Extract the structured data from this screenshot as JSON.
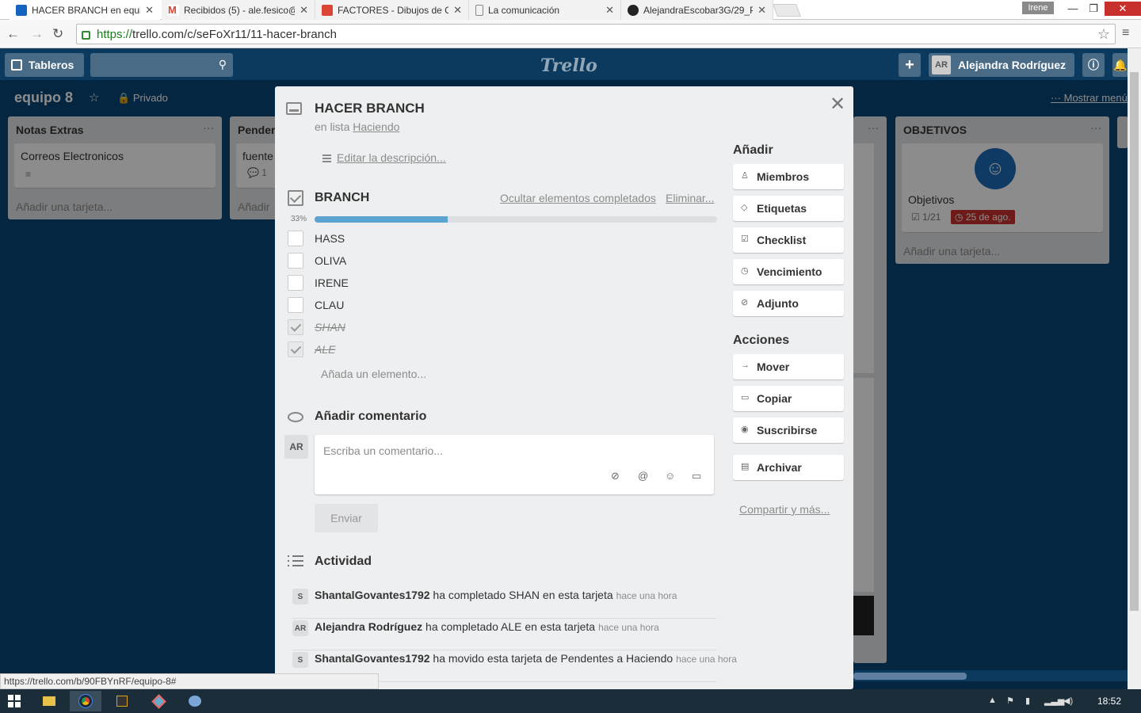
{
  "browser": {
    "tabs": [
      {
        "title": "HACER BRANCH en equip",
        "favicon_color": "#1565c0",
        "active": true
      },
      {
        "title": "Recibidos (5) - ale.fesico@",
        "favicon_color": "#d44638",
        "active": false
      },
      {
        "title": "FACTORES - Dibujos de G",
        "favicon_color": "#db4437",
        "active": false
      },
      {
        "title": "La comunicación",
        "favicon_color": "#ffffff",
        "active": false
      },
      {
        "title": "AlejandraEscobar3G/29_P",
        "favicon_color": "#222222",
        "active": false
      }
    ],
    "profile": "Irene",
    "url_scheme": "https://",
    "url_rest": "trello.com/c/seFoXr11/11-hacer-branch",
    "status_url": "https://trello.com/b/90FBYnRF/equipo-8#"
  },
  "trello_header": {
    "boards_label": "Tableros",
    "logo": "Trello",
    "user_initials": "AR",
    "user_name": "Alejandra Rodríguez"
  },
  "board": {
    "name": "equipo 8",
    "visibility": "Privado",
    "show_menu": "Mostrar menú",
    "lists": [
      {
        "title": "Notas Extras",
        "cards": [
          {
            "title": "Correos Electronicos"
          }
        ],
        "add_card": "Añadir una tarjeta..."
      },
      {
        "title": "Pender",
        "cards": [
          {
            "title": "fuente",
            "comments": "1"
          }
        ],
        "add_card": "Añadir"
      },
      {
        "title": "OBJETIVOS",
        "cards": [
          {
            "title": "Objetivos",
            "checklist": "1/21",
            "due": "25 de ago."
          }
        ],
        "add_card": "Añadir una tarjeta..."
      }
    ]
  },
  "card": {
    "title": "HACER BRANCH",
    "in_list_prefix": "en lista",
    "list_name": "Haciendo",
    "edit_description": "Editar la descripción...",
    "checklist": {
      "title": "BRANCH",
      "hide_completed": "Ocultar elementos completados",
      "delete": "Eliminar...",
      "percent_label": "33%",
      "progress": 0.33,
      "items": [
        {
          "text": "HASS",
          "done": false
        },
        {
          "text": "OLIVA",
          "done": false
        },
        {
          "text": "IRENE",
          "done": false
        },
        {
          "text": "CLAU",
          "done": false
        },
        {
          "text": "SHAN",
          "done": true
        },
        {
          "text": "ALE",
          "done": true
        }
      ],
      "add_item": "Añada un elemento..."
    },
    "comment": {
      "title": "Añadir comentario",
      "avatar": "AR",
      "placeholder": "Escriba un comentario...",
      "send": "Enviar"
    },
    "activity": {
      "title": "Actividad",
      "entries": [
        {
          "avatar": "S",
          "user": "ShantalGovantes1792",
          "action": "ha completado SHAN en esta tarjeta",
          "time": "hace una hora"
        },
        {
          "avatar": "AR",
          "user": "Alejandra Rodríguez",
          "action": "ha completado ALE en esta tarjeta",
          "time": "hace una hora"
        },
        {
          "avatar": "S",
          "user": "ShantalGovantes1792",
          "action": "ha movido esta tarjeta de Pendentes a Haciendo",
          "time": "hace una hora"
        }
      ]
    },
    "sidebar": {
      "add_title": "Añadir",
      "add_buttons": [
        "Miembros",
        "Etiquetas",
        "Checklist",
        "Vencimiento",
        "Adjunto"
      ],
      "actions_title": "Acciones",
      "action_buttons": [
        "Mover",
        "Copiar",
        "Suscribirse",
        "Archivar"
      ],
      "share": "Compartir y más..."
    }
  },
  "taskbar": {
    "clock": "18:52"
  }
}
